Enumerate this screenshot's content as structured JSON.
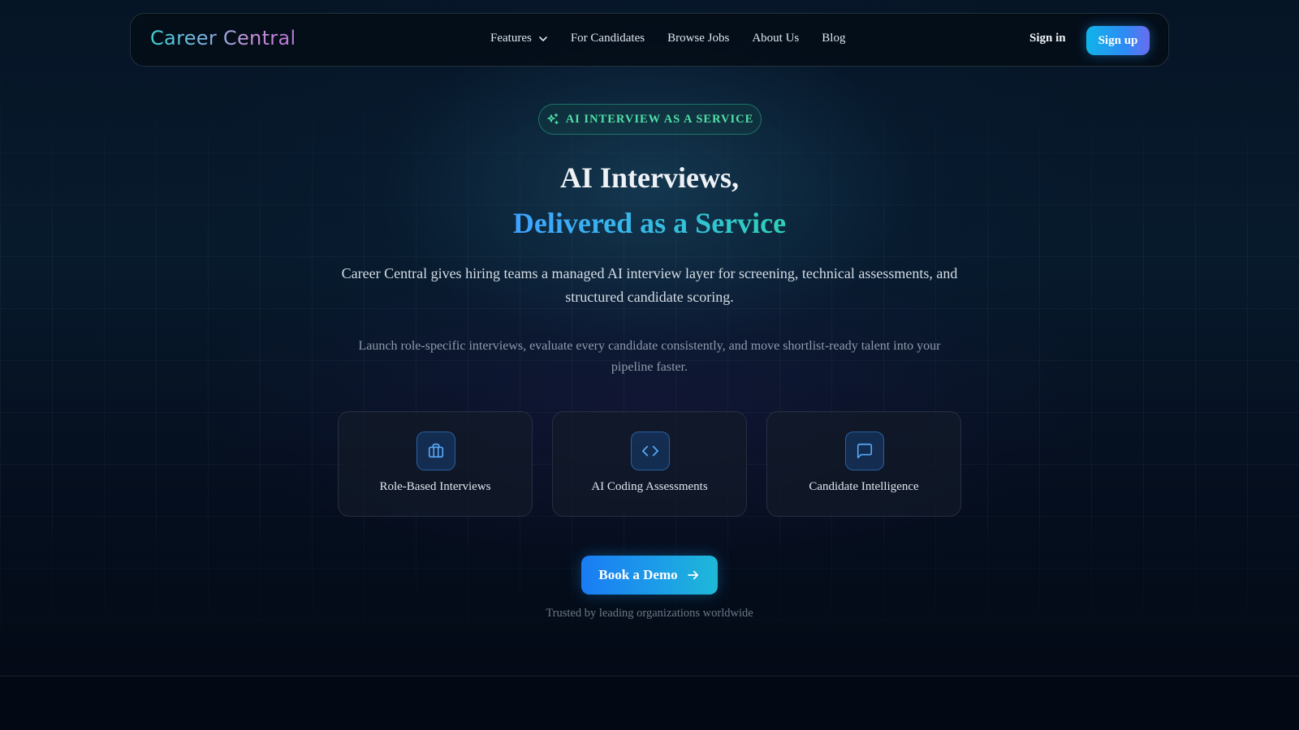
{
  "nav": {
    "logo": "Career Central",
    "links": [
      {
        "label": "Features",
        "has_dropdown": true
      },
      {
        "label": "For Candidates"
      },
      {
        "label": "Browse Jobs"
      },
      {
        "label": "About Us"
      },
      {
        "label": "Blog"
      }
    ],
    "signin_label": "Sign in",
    "signup_label": "Sign up"
  },
  "hero": {
    "badge": "AI INTERVIEW AS A SERVICE",
    "title_line1": "AI Interviews,",
    "title_line2": "Delivered as a Service",
    "lead": "Career Central gives hiring teams a managed AI interview layer for screening, technical assessments, and structured candidate scoring.",
    "sub": "Launch role-specific interviews, evaluate every candidate consistently, and move shortlist-ready talent into your pipeline faster."
  },
  "features": [
    {
      "icon": "briefcase-icon",
      "label": "Role-Based Interviews"
    },
    {
      "icon": "code-icon",
      "label": "AI Coding Assessments"
    },
    {
      "icon": "message-square-icon",
      "label": "Candidate Intelligence"
    }
  ],
  "cta": {
    "label": "Book a Demo",
    "trusted": "Trusted by leading organizations worldwide"
  },
  "colors": {
    "background": "#030914",
    "accent_green": "#4fe0a8",
    "accent_blue": "#1a7cf4",
    "accent_cyan": "#1eb8d8"
  }
}
